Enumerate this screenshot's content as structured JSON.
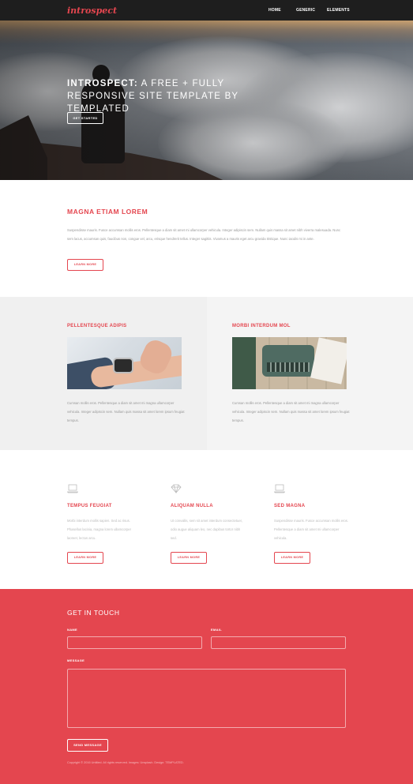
{
  "header": {
    "logo": "introspect",
    "nav": [
      "HOME",
      "GENERIC",
      "ELEMENTS"
    ]
  },
  "hero": {
    "title_strong": "INTROSPECT:",
    "title_rest": " A FREE + FULLY RESPONSIVE SITE TEMPLATE BY TEMPLATED",
    "button": "GET STARTED"
  },
  "intro": {
    "title": "MAGNA ETIAM LOREM",
    "text": "Suspendisse mauris. Fusce accumsan mollis eros. Pellentesque a diam sit amet mi ullamcorper vehicula. Integer adipiscin sem. Nullam quis massa sit amet nibh viverra malesuada. Nunc sem lacus, accumsan quis, faucibus non, congue vel, arcu, erisque hendrerit tellus. Integer sagittis. Vivamus a mauris eget arcu gravida tristique. Nunc iaculis mi in ante.",
    "button": "LEARN MORE"
  },
  "features": [
    {
      "title": "PELLENTESQUE ADIPIS",
      "text": "Cumsan mollis eros. Pellentesque a diam sit amet mi magna ullamcorper vehicula. Integer adipiscin sem. Nullam quis massa sit amet lorem ipsum feugiat tempus."
    },
    {
      "title": "MORBI INTERDUM MOL",
      "text": "Cumsan mollis eros. Pellentesque a diam sit amet mi magna ullamcorper vehicula. Integer adipiscin sem. Nullam quis massa sit amet lorem ipsum feugiat tempus."
    }
  ],
  "columns": [
    {
      "icon": "laptop-icon",
      "title": "TEMPUS FEUGIAT",
      "text": "Morbi interdum mollis sapien. Sed ac risus. Phasellus lacinia, magna lorem ullamcorper laoreet, lectus arcu.",
      "button": "LEARN MORE"
    },
    {
      "icon": "diamond-icon",
      "title": "ALIQUAM NULLA",
      "text": "Ut convallis, sem sit amet interdum consectetuer, odio augue aliquam leo, nec dapibus tortor nibh sed.",
      "button": "LEARN MORE"
    },
    {
      "icon": "laptop-icon",
      "title": "SED MAGNA",
      "text": "Suspendisse mauris. Fusce accumsan mollis eros. Pellentesque a diam sit amet mi ullamcorper vehicula.",
      "button": "LEARN MORE"
    }
  ],
  "contact": {
    "title": "GET IN TOUCH",
    "name_label": "NAME",
    "email_label": "EMAIL",
    "message_label": "MESSAGE",
    "button": "SEND MESSAGE",
    "footer": "Copyright © 2016 Untitled. All rights reserved. Images: Unsplash. Design: TEMPLATED."
  },
  "colors": {
    "accent": "#e4464f",
    "header_bg": "#1e1e1e"
  }
}
